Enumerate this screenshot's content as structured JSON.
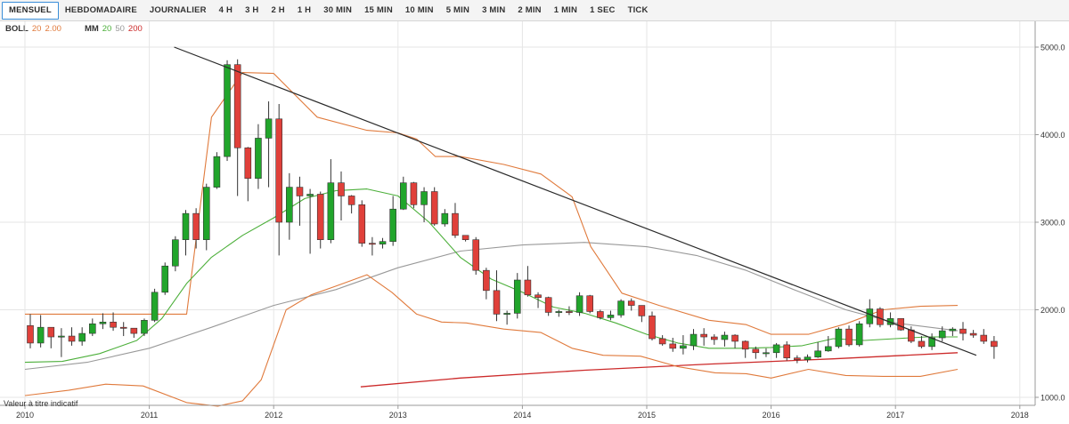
{
  "tabs": [
    {
      "label": "MENSUEL",
      "active": true
    },
    {
      "label": "HEBDOMADAIRE",
      "active": false
    },
    {
      "label": "JOURNALIER",
      "active": false
    },
    {
      "label": "4 H",
      "active": false
    },
    {
      "label": "3 H",
      "active": false
    },
    {
      "label": "2 H",
      "active": false
    },
    {
      "label": "1 H",
      "active": false
    },
    {
      "label": "30 MIN",
      "active": false
    },
    {
      "label": "15 MIN",
      "active": false
    },
    {
      "label": "10 MIN",
      "active": false
    },
    {
      "label": "5 MIN",
      "active": false
    },
    {
      "label": "3 MIN",
      "active": false
    },
    {
      "label": "2 MIN",
      "active": false
    },
    {
      "label": "1 MIN",
      "active": false
    },
    {
      "label": "1 SEC",
      "active": false
    },
    {
      "label": "TICK",
      "active": false
    }
  ],
  "indicators": {
    "boll": {
      "name": "BOLL",
      "period": "20",
      "dev": "2.00",
      "color": "#e07a3c"
    },
    "mm": {
      "name": "MM",
      "p1": "20",
      "p2": "50",
      "p3": "200",
      "c1": "#4caf3a",
      "c2": "#999999",
      "c3": "#cc2a2a"
    }
  },
  "disclaimer": "Valeur à titre indicatif",
  "chart_data": {
    "type": "candlestick",
    "x_ticks": [
      "2010",
      "2011",
      "2012",
      "2013",
      "2014",
      "2015",
      "2016",
      "2017",
      "2018"
    ],
    "y_ticks": [
      "1000.0",
      "2000.0",
      "3000.0",
      "4000.0",
      "5000.0"
    ],
    "ylim": [
      900,
      5420
    ],
    "xlim": [
      2010.0,
      2018.25
    ],
    "colors": {
      "up": "#21a52b",
      "down": "#e0403a",
      "boll": "#e07a3c",
      "ma20": "#4caf3a",
      "ma50": "#999999",
      "ma200": "#cc2a2a",
      "trend": "#2a2a2a"
    },
    "candles": [
      [
        1820,
        1620,
        1950,
        1560
      ],
      [
        1620,
        1800,
        1940,
        1570
      ],
      [
        1800,
        1690,
        1800,
        1560
      ],
      [
        1690,
        1700,
        1790,
        1460
      ],
      [
        1700,
        1640,
        1800,
        1590
      ],
      [
        1640,
        1730,
        1800,
        1590
      ],
      [
        1730,
        1840,
        1900,
        1700
      ],
      [
        1840,
        1860,
        1960,
        1780
      ],
      [
        1860,
        1800,
        1970,
        1760
      ],
      [
        1800,
        1790,
        1860,
        1700
      ],
      [
        1790,
        1730,
        1790,
        1680
      ],
      [
        1730,
        1880,
        1900,
        1700
      ],
      [
        1880,
        2200,
        2240,
        1860
      ],
      [
        2200,
        2500,
        2540,
        2170
      ],
      [
        2500,
        2800,
        2840,
        2440
      ],
      [
        2800,
        3100,
        3140,
        2620
      ],
      [
        3100,
        2800,
        3160,
        2700
      ],
      [
        2800,
        3400,
        3440,
        2680
      ],
      [
        3400,
        3750,
        3800,
        3380
      ],
      [
        3750,
        4800,
        4850,
        3700
      ],
      [
        4800,
        3850,
        4860,
        3300
      ],
      [
        3850,
        3500,
        3860,
        3240
      ],
      [
        3500,
        3960,
        4120,
        3380
      ],
      [
        3960,
        4180,
        4380,
        3400
      ],
      [
        4180,
        3000,
        4350,
        2620
      ],
      [
        3000,
        3400,
        3560,
        2800
      ],
      [
        3400,
        3300,
        3520,
        2960
      ],
      [
        3300,
        3320,
        3380,
        2640
      ],
      [
        3320,
        2800,
        3350,
        2700
      ],
      [
        2800,
        3450,
        3720,
        2760
      ],
      [
        3450,
        3300,
        3580,
        3020
      ],
      [
        3300,
        3200,
        3310,
        3100
      ],
      [
        3200,
        2760,
        3250,
        2720
      ],
      [
        2760,
        2750,
        2830,
        2620
      ],
      [
        2750,
        2780,
        2820,
        2700
      ],
      [
        2780,
        3150,
        3300,
        2730
      ],
      [
        3150,
        3450,
        3520,
        3140
      ],
      [
        3450,
        3200,
        3460,
        3160
      ],
      [
        3200,
        3350,
        3400,
        3000
      ],
      [
        3350,
        2980,
        3400,
        2960
      ],
      [
        2980,
        3100,
        3150,
        2950
      ],
      [
        3100,
        2850,
        3220,
        2820
      ],
      [
        2850,
        2800,
        2850,
        2780
      ],
      [
        2800,
        2450,
        2830,
        2400
      ],
      [
        2450,
        2220,
        2480,
        2120
      ],
      [
        2220,
        1950,
        2450,
        1870
      ],
      [
        1950,
        1960,
        1990,
        1830
      ],
      [
        1960,
        2340,
        2420,
        1900
      ],
      [
        2340,
        2170,
        2500,
        2150
      ],
      [
        2170,
        2140,
        2200,
        2020
      ],
      [
        2140,
        1970,
        2150,
        1930
      ],
      [
        1970,
        1980,
        2000,
        1920
      ],
      [
        1980,
        1970,
        2040,
        1940
      ],
      [
        1970,
        2160,
        2200,
        1930
      ],
      [
        2160,
        1980,
        2170,
        1960
      ],
      [
        1980,
        1910,
        2000,
        1890
      ],
      [
        1910,
        1940,
        1990,
        1880
      ],
      [
        1940,
        2100,
        2120,
        1910
      ],
      [
        2100,
        2050,
        2130,
        1990
      ],
      [
        2050,
        1930,
        2050,
        1860
      ],
      [
        1930,
        1670,
        1980,
        1650
      ],
      [
        1670,
        1610,
        1710,
        1590
      ],
      [
        1610,
        1560,
        1680,
        1520
      ],
      [
        1560,
        1590,
        1710,
        1490
      ],
      [
        1590,
        1720,
        1780,
        1540
      ],
      [
        1720,
        1690,
        1790,
        1590
      ],
      [
        1690,
        1660,
        1720,
        1600
      ],
      [
        1660,
        1710,
        1750,
        1580
      ],
      [
        1710,
        1640,
        1720,
        1560
      ],
      [
        1640,
        1550,
        1650,
        1450
      ],
      [
        1550,
        1510,
        1580,
        1440
      ],
      [
        1510,
        1510,
        1560,
        1460
      ],
      [
        1510,
        1600,
        1620,
        1450
      ],
      [
        1600,
        1450,
        1640,
        1420
      ],
      [
        1450,
        1430,
        1480,
        1390
      ],
      [
        1430,
        1460,
        1490,
        1400
      ],
      [
        1460,
        1530,
        1630,
        1450
      ],
      [
        1530,
        1580,
        1700,
        1520
      ],
      [
        1580,
        1780,
        1800,
        1560
      ],
      [
        1780,
        1600,
        1820,
        1580
      ],
      [
        1600,
        1840,
        1870,
        1580
      ],
      [
        1840,
        2010,
        2120,
        1800
      ],
      [
        2010,
        1830,
        2030,
        1800
      ],
      [
        1830,
        1900,
        1970,
        1800
      ],
      [
        1900,
        1770,
        1900,
        1760
      ],
      [
        1770,
        1640,
        1810,
        1620
      ],
      [
        1640,
        1580,
        1700,
        1560
      ],
      [
        1580,
        1680,
        1730,
        1540
      ],
      [
        1680,
        1760,
        1810,
        1640
      ],
      [
        1760,
        1780,
        1800,
        1700
      ],
      [
        1780,
        1730,
        1860,
        1650
      ],
      [
        1730,
        1710,
        1770,
        1680
      ],
      [
        1710,
        1640,
        1780,
        1610
      ],
      [
        1640,
        1580,
        1700,
        1440
      ]
    ],
    "series": {
      "boll_upper_x": [
        2010.0,
        2011.3,
        2011.5,
        2011.75,
        2012.0,
        2012.35,
        2012.75,
        2013.0,
        2013.15,
        2013.3,
        2013.5,
        2013.85,
        2014.15,
        2014.4,
        2014.55,
        2014.8,
        2015.1,
        2015.5,
        2015.8,
        2016.0,
        2016.3,
        2016.6,
        2016.9,
        2017.2,
        2017.5
      ],
      "boll_upper_y": [
        1950,
        1950,
        4200,
        4710,
        4700,
        4200,
        4050,
        4020,
        3950,
        3750,
        3750,
        3660,
        3550,
        3290,
        2720,
        2190,
        2050,
        1880,
        1830,
        1720,
        1720,
        1840,
        2000,
        2040,
        2050
      ],
      "boll_lower_x": [
        2010.0,
        2010.35,
        2010.65,
        2010.95,
        2011.3,
        2011.55,
        2011.75,
        2011.9,
        2012.1,
        2012.3,
        2012.5,
        2012.75,
        2012.95,
        2013.15,
        2013.35,
        2013.55,
        2013.85,
        2014.15,
        2014.4,
        2014.65,
        2014.95,
        2015.25,
        2015.55,
        2015.8,
        2016.0,
        2016.3,
        2016.6,
        2016.9,
        2017.2,
        2017.5
      ],
      "boll_lower_y": [
        1020,
        1080,
        1150,
        1130,
        940,
        900,
        960,
        1200,
        2000,
        2170,
        2270,
        2400,
        2200,
        1950,
        1860,
        1850,
        1780,
        1740,
        1560,
        1480,
        1470,
        1350,
        1280,
        1270,
        1220,
        1320,
        1250,
        1240,
        1240,
        1320
      ],
      "ma20_x": [
        2010.0,
        2010.3,
        2010.6,
        2010.9,
        2011.1,
        2011.3,
        2011.5,
        2011.75,
        2012.0,
        2012.25,
        2012.5,
        2012.75,
        2013.0,
        2013.25,
        2013.5,
        2013.75,
        2014.0,
        2014.25,
        2014.5,
        2014.75,
        2015.0,
        2015.25,
        2015.5,
        2015.75,
        2016.0,
        2016.25,
        2016.5,
        2016.75,
        2017.0,
        2017.25,
        2017.5
      ],
      "ma20_y": [
        1400,
        1410,
        1500,
        1650,
        1900,
        2300,
        2600,
        2850,
        3050,
        3270,
        3360,
        3380,
        3300,
        3000,
        2600,
        2350,
        2200,
        2030,
        1960,
        1850,
        1720,
        1620,
        1560,
        1560,
        1570,
        1590,
        1670,
        1650,
        1670,
        1690,
        1690
      ],
      "ma50_x": [
        2010.0,
        2010.5,
        2011.0,
        2011.5,
        2012.0,
        2012.5,
        2013.0,
        2013.5,
        2014.0,
        2014.5,
        2015.0,
        2015.4,
        2015.8,
        2016.2,
        2016.6,
        2017.0,
        2017.5
      ],
      "ma50_y": [
        1320,
        1400,
        1560,
        1800,
        2050,
        2230,
        2480,
        2670,
        2740,
        2770,
        2720,
        2620,
        2450,
        2220,
        2000,
        1850,
        1760
      ],
      "ma200_x": [
        2012.7,
        2013.5,
        2014.5,
        2015.5,
        2016.5,
        2017.5
      ],
      "ma200_y": [
        1120,
        1220,
        1310,
        1380,
        1440,
        1510
      ],
      "trend_x": [
        2011.2,
        2017.65
      ],
      "trend_y": [
        5000,
        1480
      ]
    }
  }
}
